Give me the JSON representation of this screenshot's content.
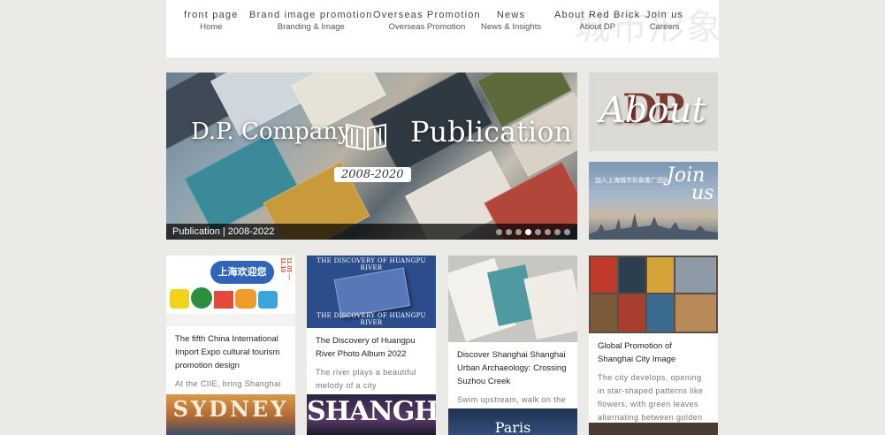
{
  "nav": {
    "watermark": "城市形象",
    "items": [
      {
        "en": "front page",
        "sub": "Home"
      },
      {
        "en": "Brand image promotion",
        "sub": "Branding & Image"
      },
      {
        "en": "Overseas Promotion",
        "sub": "Overseas Promotion"
      },
      {
        "en": "News",
        "sub": "News & Insights"
      },
      {
        "en": "About Red Brick",
        "sub": "About DP"
      },
      {
        "en": "Join us",
        "sub": "Careers"
      }
    ]
  },
  "hero": {
    "left_text": "D.P. Company",
    "right_text": "Publication",
    "years": "2008-2020",
    "caption": "Publication | 2008-2022",
    "dots_total": 8,
    "active_dot": 4
  },
  "tiles": {
    "about": {
      "letters": "DP",
      "word": "About"
    },
    "join": {
      "cn": "加入上海城市形象推广团队",
      "word_line1": "Join",
      "word_line2": "us"
    }
  },
  "cards": [
    {
      "title": "The fifth China International Import Expo cultural tourism promotion design",
      "desc": "At the CIIE, bring Shanghai home!",
      "image_text": "上海欢迎您",
      "image_side": "11.05 — 11.10"
    },
    {
      "title": "The Discovery of Huangpu River Photo Album 2022",
      "desc": "The river plays a beautiful melody of a city",
      "image_text": "THE DISCOVERY OF HUANGPU RIVER"
    },
    {
      "title": "Discover Shanghai Shanghai Urban Archaeology: Crossing Suzhou Creek",
      "desc": "Swim upstream, walk on the bridge, and cross the Suzhou"
    },
    {
      "title": "Global Promotion of Shanghai City Image",
      "desc": "The city develops, opening in star-shaped patterns like flowers, with green leaves alternating between golden"
    }
  ],
  "bottom": {
    "sydney": "SYDNEY",
    "shanghai": "SHANGHAI",
    "paris": "Paris"
  }
}
